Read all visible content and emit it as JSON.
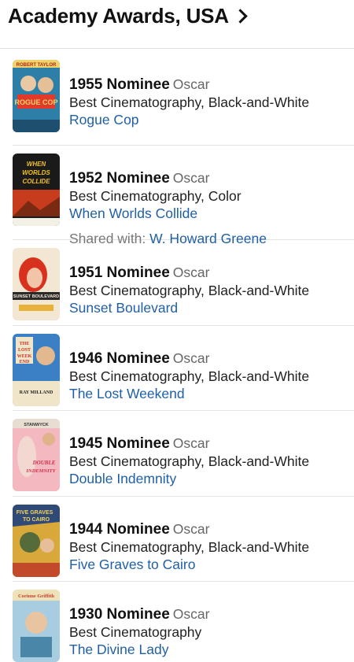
{
  "header": {
    "title": "Academy Awards, USA"
  },
  "items": [
    {
      "year_label": "1955 Nominee",
      "award": "Oscar",
      "category": "Best Cinematography, Black-and-White",
      "film": "Rogue Cop",
      "poster_text": "ROGUE COP",
      "poster_top": "ROBERT TAYLOR",
      "colors": {
        "bg": "#2e7fa7",
        "accent": "#e23a2a",
        "band": "#f1d36b"
      }
    },
    {
      "year_label": "1952 Nominee",
      "award": "Oscar",
      "category": "Best Cinematography, Color",
      "film": "When Worlds Collide",
      "shared_label": "Shared with:",
      "shared_with": "W. Howard Greene",
      "poster_text": "WHEN WORLDS COLLIDE",
      "colors": {
        "bg": "#1a1a1a",
        "accent": "#f4c21a",
        "band": "#c83c1e"
      }
    },
    {
      "year_label": "1951 Nominee",
      "award": "Oscar",
      "category": "Best Cinematography, Black-and-White",
      "film": "Sunset Boulevard",
      "poster_text": "SUNSET BOULEVARD",
      "colors": {
        "bg": "#f3e6d2",
        "accent": "#d8321f",
        "band": "#e8b23a"
      }
    },
    {
      "year_label": "1946 Nominee",
      "award": "Oscar",
      "category": "Best Cinematography, Black-and-White",
      "film": "The Lost Weekend",
      "poster_text": "THE LOST WEEK END",
      "poster_bottom": "RAY MILLAND",
      "colors": {
        "bg": "#3b7fc4",
        "accent": "#c8312a",
        "band": "#f0e5c8"
      }
    },
    {
      "year_label": "1945 Nominee",
      "award": "Oscar",
      "category": "Best Cinematography, Black-and-White",
      "film": "Double Indemnity",
      "poster_text": "DOUBLE INDEMNITY",
      "poster_top": "STANWYCK",
      "colors": {
        "bg": "#f3b8c0",
        "accent": "#d42f4a",
        "band": "#e7ddd0"
      }
    },
    {
      "year_label": "1944 Nominee",
      "award": "Oscar",
      "category": "Best Cinematography, Black-and-White",
      "film": "Five Graves to Cairo",
      "poster_text": "FIVE GRAVES TO CAIRO",
      "colors": {
        "bg": "#d8a83a",
        "accent": "#2f4a76",
        "band": "#c24a2a"
      }
    },
    {
      "year_label": "1930 Nominee",
      "award": "Oscar",
      "category": "Best Cinematography",
      "film": "The Divine Lady",
      "poster_text": "Corinne Griffith",
      "colors": {
        "bg": "#a8cde0",
        "accent": "#c4422e",
        "band": "#f0e2b8"
      }
    }
  ]
}
